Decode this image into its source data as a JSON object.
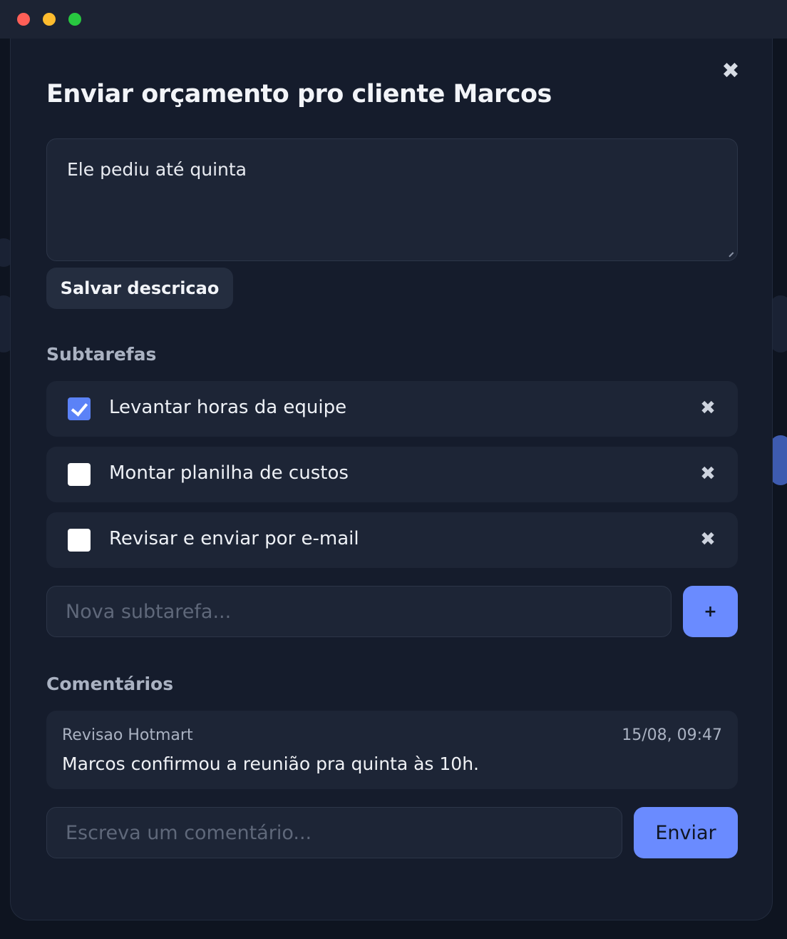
{
  "window": {
    "controls": [
      "close",
      "minimize",
      "maximize"
    ]
  },
  "modal": {
    "title": "Enviar orçamento pro cliente Marcos",
    "close_icon": "close-icon"
  },
  "description": {
    "value": "Ele pediu até quinta",
    "save_label": "Salvar descricao"
  },
  "subtasks": {
    "heading": "Subtarefas",
    "items": [
      {
        "label": "Levantar horas da equipe",
        "checked": true
      },
      {
        "label": "Montar planilha de custos",
        "checked": false
      },
      {
        "label": "Revisar e enviar por e-mail",
        "checked": false
      }
    ],
    "new_placeholder": "Nova subtarefa...",
    "add_label": "+"
  },
  "comments": {
    "heading": "Comentários",
    "items": [
      {
        "author": "Revisao Hotmart",
        "time": "15/08, 09:47",
        "text": "Marcos confirmou a reunião pra quinta às 10h."
      }
    ],
    "input_placeholder": "Escreva um comentário...",
    "send_label": "Enviar"
  },
  "colors": {
    "accent": "#6a8bff",
    "checkbox_checked": "#5b82f7",
    "modal_bg": "#151c2c",
    "card_bg": "#1d2536"
  }
}
